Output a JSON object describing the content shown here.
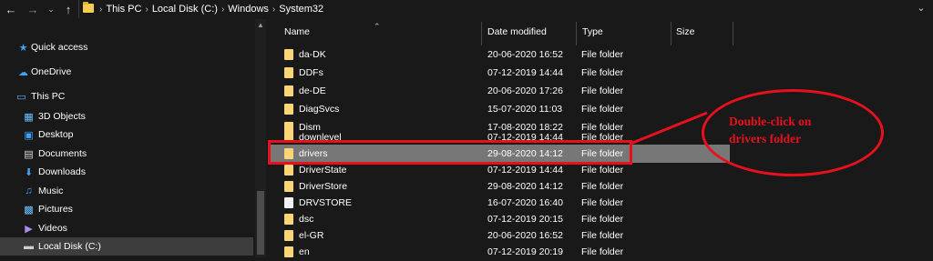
{
  "address": {
    "crumbs": [
      "This PC",
      "Local Disk (C:)",
      "Windows",
      "System32"
    ]
  },
  "sidebar": {
    "items": [
      {
        "label": "Quick access",
        "icon": "star-icon"
      },
      {
        "label": "OneDrive",
        "icon": "cloud-icon"
      },
      {
        "label": "This PC",
        "icon": "computer-icon"
      },
      {
        "label": "3D Objects",
        "icon": "cube-icon"
      },
      {
        "label": "Desktop",
        "icon": "desktop-icon"
      },
      {
        "label": "Documents",
        "icon": "document-icon"
      },
      {
        "label": "Downloads",
        "icon": "download-icon"
      },
      {
        "label": "Music",
        "icon": "music-icon"
      },
      {
        "label": "Pictures",
        "icon": "picture-icon"
      },
      {
        "label": "Videos",
        "icon": "video-icon"
      },
      {
        "label": "Local Disk (C:)",
        "icon": "drive-icon"
      }
    ]
  },
  "columns": {
    "name": "Name",
    "date": "Date modified",
    "type": "Type",
    "size": "Size"
  },
  "files": [
    {
      "name": "da-DK",
      "date": "20-06-2020 16:52",
      "type": "File folder"
    },
    {
      "name": "DDFs",
      "date": "07-12-2019 14:44",
      "type": "File folder"
    },
    {
      "name": "de-DE",
      "date": "20-06-2020 17:26",
      "type": "File folder"
    },
    {
      "name": "DiagSvcs",
      "date": "15-07-2020 11:03",
      "type": "File folder"
    },
    {
      "name": "Dism",
      "date": "17-08-2020 18:22",
      "type": "File folder"
    },
    {
      "name": "downlevel",
      "date": "07-12-2019 14:44",
      "type": "File folder"
    },
    {
      "name": "drivers",
      "date": "29-08-2020 14:12",
      "type": "File folder"
    },
    {
      "name": "DriverState",
      "date": "07-12-2019 14:44",
      "type": "File folder"
    },
    {
      "name": "DriverStore",
      "date": "29-08-2020 14:12",
      "type": "File folder"
    },
    {
      "name": "DRVSTORE",
      "date": "16-07-2020 16:40",
      "type": "File folder"
    },
    {
      "name": "dsc",
      "date": "07-12-2019 20:15",
      "type": "File folder"
    },
    {
      "name": "el-GR",
      "date": "20-06-2020 16:52",
      "type": "File folder"
    },
    {
      "name": "en",
      "date": "07-12-2019 20:19",
      "type": "File folder"
    }
  ],
  "annotation": {
    "line1": "Double-click on",
    "line2": "drivers folder"
  },
  "colors": {
    "accent": "#e8101d",
    "selection": "#777777",
    "background": "#191919"
  }
}
